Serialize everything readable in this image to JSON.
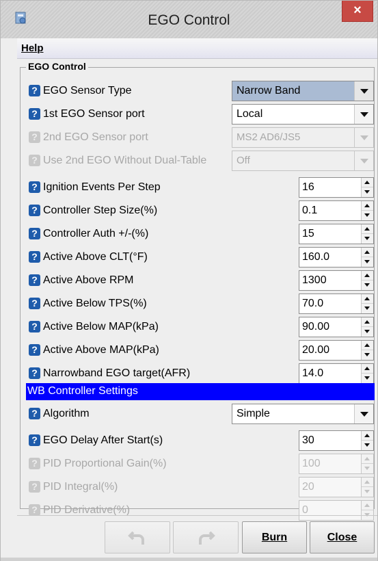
{
  "window": {
    "title": "EGO Control",
    "close_label": "×"
  },
  "menu": {
    "help": "Help"
  },
  "group": {
    "title": "EGO Control"
  },
  "rows": {
    "sensor_type": {
      "label": "EGO Sensor Type",
      "value": "Narrow Band"
    },
    "sensor_port1": {
      "label": "1st EGO Sensor port",
      "value": "Local"
    },
    "sensor_port2": {
      "label": "2nd EGO Sensor port",
      "value": "MS2 AD6/JS5"
    },
    "dual_table": {
      "label": "Use 2nd EGO Without Dual-Table",
      "value": "Off"
    },
    "ign_events": {
      "label": "Ignition Events Per Step",
      "value": "16"
    },
    "step_size": {
      "label": "Controller Step Size(%)",
      "value": "0.1"
    },
    "auth": {
      "label": "Controller Auth +/-(%)",
      "value": "15"
    },
    "clt": {
      "label": "Active Above CLT(°F)",
      "value": "160.0"
    },
    "rpm": {
      "label": "Active Above RPM",
      "value": "1300"
    },
    "tps": {
      "label": "Active Below TPS(%)",
      "value": "70.0"
    },
    "map_below": {
      "label": "Active Below MAP(kPa)",
      "value": "90.00"
    },
    "map_above": {
      "label": "Active Above MAP(kPa)",
      "value": "20.00"
    },
    "nb_target": {
      "label": "Narrowband EGO target(AFR)",
      "value": "14.0"
    }
  },
  "wb_section": {
    "title": "WB Controller Settings"
  },
  "wb_rows": {
    "algorithm": {
      "label": "Algorithm",
      "value": "Simple"
    },
    "delay": {
      "label": "EGO Delay After Start(s)",
      "value": "30"
    },
    "pid_p": {
      "label": "PID Proportional Gain(%)",
      "value": "100"
    },
    "pid_i": {
      "label": "PID Integral(%)",
      "value": "20"
    },
    "pid_d": {
      "label": "PID Derivative(%)",
      "value": "0"
    }
  },
  "buttons": {
    "burn": "Burn",
    "close": "Close"
  },
  "icons": {
    "help": "question-icon",
    "undo": "undo-icon",
    "redo": "redo-icon"
  },
  "colors": {
    "section_bar": "#0000ff",
    "help_icon": "#1f5cab",
    "close_button": "#c74a44"
  }
}
